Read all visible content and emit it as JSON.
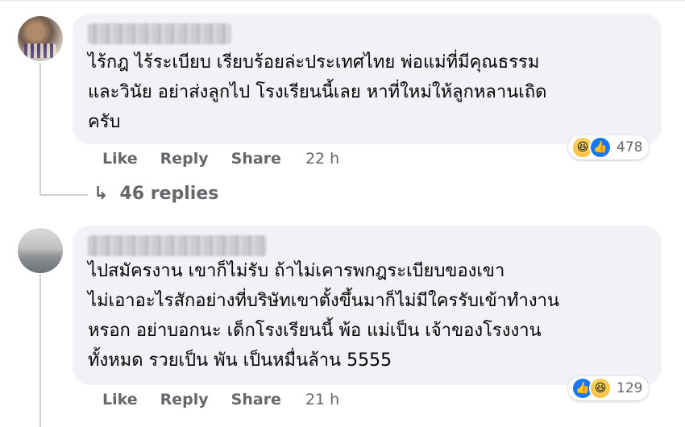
{
  "comments": [
    {
      "text": "ไร้กฎ ไร้ระเบียบ เรียบร้อยล่ะประเทศไทย พ่อแม่ที่มีคุณธรรม\nและวินัย อย่าส่งลูกไป โรงเรียนนี้เลย หาที่ใหม่ให้ลูกหลานเถิด\nครับ",
      "reaction_icons": [
        "haha-icon",
        "like-icon"
      ],
      "reaction_count": "478",
      "like_label": "Like",
      "reply_label": "Reply",
      "share_label": "Share",
      "time": "22 h",
      "replies_label": "46 replies"
    },
    {
      "text": "ไปสมัครงาน เขาก็ไม่รับ ถ้าไม่เคารพกฎระเบียบของเขา\nไม่เอาอะไรสักอย่างที่บริษัทเขาตั้งขึ้นมาก็ไม่มีใครรับเข้าทำงาน\nหรอก อย่าบอกนะ เด็กโรงเรียนนี้ พ้อ แม่เป็น เจ้าของโรงงาน\nทั้งหมด รวยเป็น พัน เป็นหมื่นล้าน 5555",
      "reaction_icons": [
        "like-icon",
        "haha-icon"
      ],
      "reaction_count": "129",
      "like_label": "Like",
      "reply_label": "Reply",
      "share_label": "Share",
      "time": "21 h"
    }
  ],
  "colors": {
    "bubble": "#f0f2f5",
    "meta_text": "#65676b",
    "like_blue": "#1877f2"
  }
}
